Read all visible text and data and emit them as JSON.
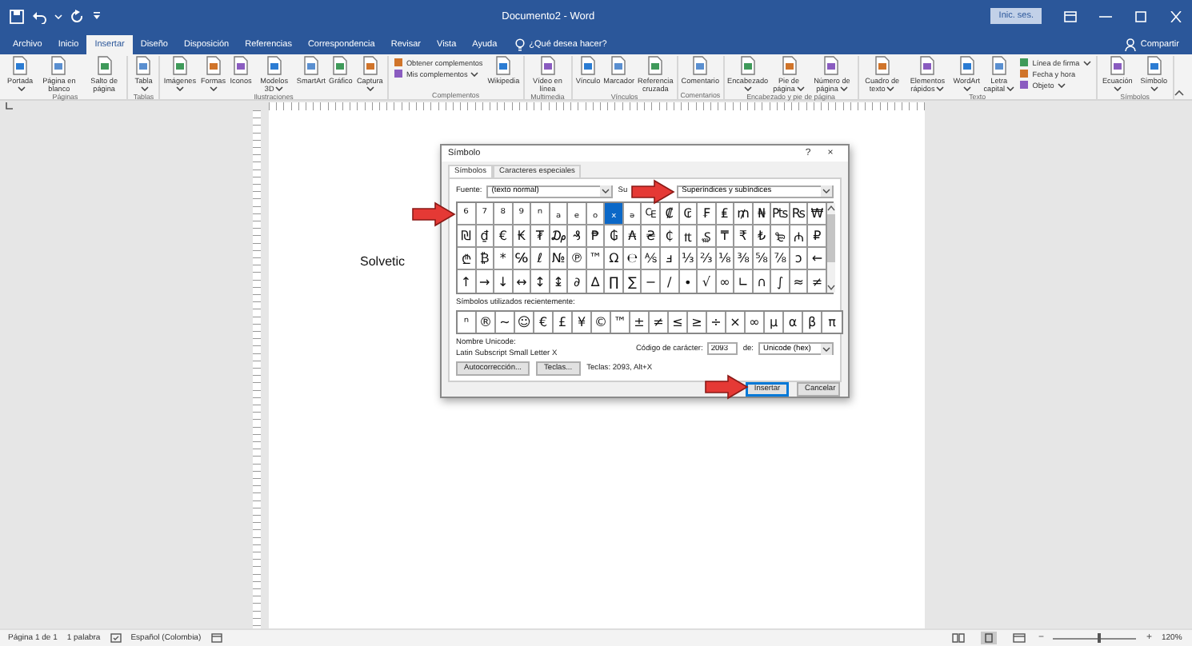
{
  "window": {
    "title": "Documento2 - Word",
    "sign_in": "Inic. ses."
  },
  "ribbon_tabs": [
    {
      "label": "Archivo",
      "selected": false
    },
    {
      "label": "Inicio",
      "selected": false
    },
    {
      "label": "Insertar",
      "selected": true
    },
    {
      "label": "Diseño",
      "selected": false
    },
    {
      "label": "Disposición",
      "selected": false
    },
    {
      "label": "Referencias",
      "selected": false
    },
    {
      "label": "Correspondencia",
      "selected": false
    },
    {
      "label": "Revisar",
      "selected": false
    },
    {
      "label": "Vista",
      "selected": false
    },
    {
      "label": "Ayuda",
      "selected": false
    }
  ],
  "tell_me": "¿Qué desea hacer?",
  "share": "Compartir",
  "ribbon_groups": [
    {
      "name": "Páginas",
      "items": [
        {
          "label": "Portada",
          "kind": "large",
          "dropdown": true
        },
        {
          "label": "Página en blanco",
          "kind": "large",
          "dropdown": false
        },
        {
          "label": "Salto de página",
          "kind": "large",
          "dropdown": false
        }
      ]
    },
    {
      "name": "Tablas",
      "items": [
        {
          "label": "Tabla",
          "kind": "large",
          "dropdown": true
        }
      ]
    },
    {
      "name": "Ilustraciones",
      "items": [
        {
          "label": "Imágenes",
          "kind": "large",
          "dropdown": true
        },
        {
          "label": "Formas",
          "kind": "large",
          "dropdown": true
        },
        {
          "label": "Iconos",
          "kind": "large",
          "dropdown": false
        },
        {
          "label": "Modelos 3D",
          "kind": "large",
          "dropdown": true
        },
        {
          "label": "SmartArt",
          "kind": "large",
          "dropdown": false
        },
        {
          "label": "Gráfico",
          "kind": "large",
          "dropdown": false
        },
        {
          "label": "Captura",
          "kind": "large",
          "dropdown": true
        }
      ]
    },
    {
      "name": "Complementos",
      "items": [
        {
          "label": "Obtener complementos",
          "kind": "small",
          "dropdown": false
        },
        {
          "label": "Mis complementos",
          "kind": "small",
          "dropdown": true
        },
        {
          "label": "Wikipedia",
          "kind": "large",
          "dropdown": false
        }
      ]
    },
    {
      "name": "Multimedia",
      "items": [
        {
          "label": "Vídeo en línea",
          "kind": "large",
          "dropdown": false
        }
      ]
    },
    {
      "name": "Vínculos",
      "items": [
        {
          "label": "Vínculo",
          "kind": "large",
          "dropdown": false
        },
        {
          "label": "Marcador",
          "kind": "large",
          "dropdown": false
        },
        {
          "label": "Referencia cruzada",
          "kind": "large",
          "dropdown": false
        }
      ]
    },
    {
      "name": "Comentarios",
      "items": [
        {
          "label": "Comentario",
          "kind": "large",
          "dropdown": false
        }
      ]
    },
    {
      "name": "Encabezado y pie de página",
      "items": [
        {
          "label": "Encabezado",
          "kind": "large",
          "dropdown": true
        },
        {
          "label": "Pie de página",
          "kind": "large",
          "dropdown": true
        },
        {
          "label": "Número de página",
          "kind": "large",
          "dropdown": true
        }
      ]
    },
    {
      "name": "Texto",
      "items": [
        {
          "label": "Cuadro de texto",
          "kind": "large",
          "dropdown": true
        },
        {
          "label": "Elementos rápidos",
          "kind": "large",
          "dropdown": true
        },
        {
          "label": "WordArt",
          "kind": "large",
          "dropdown": true
        },
        {
          "label": "Letra capital",
          "kind": "large",
          "dropdown": true
        },
        {
          "label": "Línea de firma",
          "kind": "small",
          "dropdown": true
        },
        {
          "label": "Fecha y hora",
          "kind": "small",
          "dropdown": false
        },
        {
          "label": "Objeto",
          "kind": "small",
          "dropdown": true
        }
      ]
    },
    {
      "name": "Símbolos",
      "items": [
        {
          "label": "Ecuación",
          "kind": "large",
          "dropdown": true
        },
        {
          "label": "Símbolo",
          "kind": "large",
          "dropdown": true
        }
      ]
    }
  ],
  "document": {
    "text": "Solvetic"
  },
  "dialog": {
    "title": "Símbolo",
    "help": "?",
    "close": "×",
    "tabs": [
      {
        "label": "Símbolos",
        "selected": true
      },
      {
        "label": "Caracteres especiales",
        "selected": false
      }
    ],
    "font_label": "Fuente:",
    "font_value": "(texto normal)",
    "subset_label": "Su",
    "subset_value": "Superíndices y subíndices",
    "symbols": [
      {
        "char": "⁶",
        "selected": false
      },
      {
        "char": "⁷",
        "selected": false
      },
      {
        "char": "⁸",
        "selected": false
      },
      {
        "char": "⁹",
        "selected": false
      },
      {
        "char": "ⁿ",
        "selected": false
      },
      {
        "char": "ₐ",
        "selected": false
      },
      {
        "char": "ₑ",
        "selected": false
      },
      {
        "char": "ₒ",
        "selected": false
      },
      {
        "char": "ₓ",
        "selected": true
      },
      {
        "char": "ₔ",
        "selected": false
      },
      {
        "char": "₠",
        "selected": false
      },
      {
        "char": "₡",
        "selected": false
      },
      {
        "char": "₢",
        "selected": false
      },
      {
        "char": "₣",
        "selected": false
      },
      {
        "char": "₤",
        "selected": false
      },
      {
        "char": "₥",
        "selected": false
      },
      {
        "char": "₦",
        "selected": false
      },
      {
        "char": "₧",
        "selected": false
      },
      {
        "char": "₨",
        "selected": false
      },
      {
        "char": "₩",
        "selected": false
      },
      {
        "char": "₪",
        "selected": false
      },
      {
        "char": "₫",
        "selected": false
      },
      {
        "char": "€",
        "selected": false
      },
      {
        "char": "₭",
        "selected": false
      },
      {
        "char": "₮",
        "selected": false
      },
      {
        "char": "₯",
        "selected": false
      },
      {
        "char": "₰",
        "selected": false
      },
      {
        "char": "₱",
        "selected": false
      },
      {
        "char": "₲",
        "selected": false
      },
      {
        "char": "₳",
        "selected": false
      },
      {
        "char": "₴",
        "selected": false
      },
      {
        "char": "₵",
        "selected": false
      },
      {
        "char": "₶",
        "selected": false
      },
      {
        "char": "₷",
        "selected": false
      },
      {
        "char": "₸",
        "selected": false
      },
      {
        "char": "₹",
        "selected": false
      },
      {
        "char": "₺",
        "selected": false
      },
      {
        "char": "₻",
        "selected": false
      },
      {
        "char": "₼",
        "selected": false
      },
      {
        "char": "₽",
        "selected": false
      },
      {
        "char": "₾",
        "selected": false
      },
      {
        "char": "₿",
        "selected": false
      },
      {
        "char": "*",
        "selected": false
      },
      {
        "char": "℅",
        "selected": false
      },
      {
        "char": "ℓ",
        "selected": false
      },
      {
        "char": "№",
        "selected": false
      },
      {
        "char": "℗",
        "selected": false
      },
      {
        "char": "™",
        "selected": false
      },
      {
        "char": "Ω",
        "selected": false
      },
      {
        "char": "℮",
        "selected": false
      },
      {
        "char": "⅍",
        "selected": false
      },
      {
        "char": "ⅎ",
        "selected": false
      },
      {
        "char": "⅓",
        "selected": false
      },
      {
        "char": "⅔",
        "selected": false
      },
      {
        "char": "⅛",
        "selected": false
      },
      {
        "char": "⅜",
        "selected": false
      },
      {
        "char": "⅝",
        "selected": false
      },
      {
        "char": "⅞",
        "selected": false
      },
      {
        "char": "ↄ",
        "selected": false
      },
      {
        "char": "←",
        "selected": false
      },
      {
        "char": "↑",
        "selected": false
      },
      {
        "char": "→",
        "selected": false
      },
      {
        "char": "↓",
        "selected": false
      },
      {
        "char": "↔",
        "selected": false
      },
      {
        "char": "↕",
        "selected": false
      },
      {
        "char": "↨",
        "selected": false
      },
      {
        "char": "∂",
        "selected": false
      },
      {
        "char": "∆",
        "selected": false
      },
      {
        "char": "∏",
        "selected": false
      },
      {
        "char": "∑",
        "selected": false
      },
      {
        "char": "−",
        "selected": false
      },
      {
        "char": "∕",
        "selected": false
      },
      {
        "char": "∙",
        "selected": false
      },
      {
        "char": "√",
        "selected": false
      },
      {
        "char": "∞",
        "selected": false
      },
      {
        "char": "∟",
        "selected": false
      },
      {
        "char": "∩",
        "selected": false
      },
      {
        "char": "∫",
        "selected": false
      },
      {
        "char": "≈",
        "selected": false
      },
      {
        "char": "≠",
        "selected": false
      }
    ],
    "recent_label": "Símbolos utilizados recientemente:",
    "recent": [
      "ⁿ",
      "®",
      "~",
      "☺",
      "€",
      "£",
      "¥",
      "©",
      "™",
      "±",
      "≠",
      "≤",
      "≥",
      "÷",
      "×",
      "∞",
      "µ",
      "α",
      "β",
      "π"
    ],
    "unicode_name_label": "Nombre Unicode:",
    "unicode_name": "Latin Subscript Small Letter X",
    "char_code_label": "Código de carácter:",
    "char_code": "2093",
    "from_label": "de:",
    "from_value": "Unicode (hex)",
    "autocorrect_button": "Autocorrección...",
    "keys_button": "Teclas...",
    "shortcut": "Teclas: 2093, Alt+X",
    "insert_button": "Insertar",
    "cancel_button": "Cancelar"
  },
  "status_bar": {
    "page": "Página 1 de 1",
    "words": "1 palabra",
    "language": "Español (Colombia)",
    "zoom": "120%",
    "zoom_out": "−",
    "zoom_in": "+",
    "zoom_slider": {
      "level": 0.55
    }
  }
}
